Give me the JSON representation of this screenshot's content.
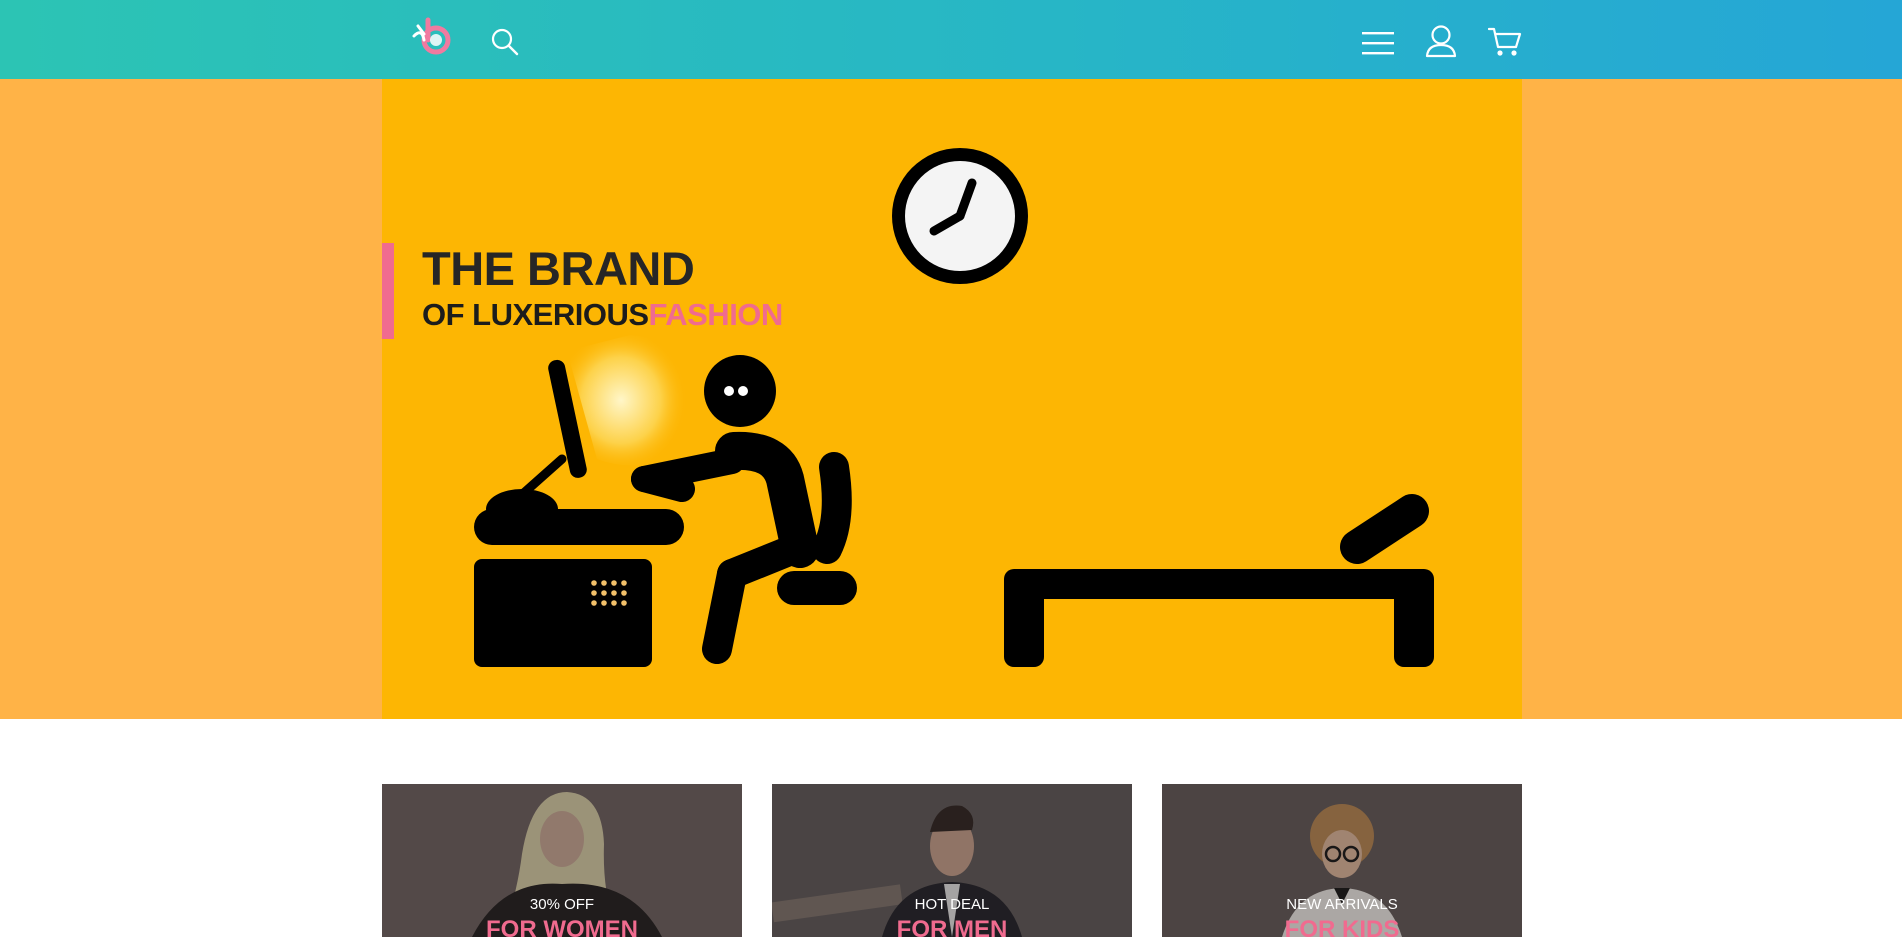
{
  "header": {
    "logo": "brand-logo",
    "icons": [
      "search-icon",
      "menu-icon",
      "user-icon",
      "cart-icon"
    ]
  },
  "hero": {
    "title": "THE BRAND",
    "subtitle_main": "OF LUXERIOUS",
    "subtitle_accent": "FASHION",
    "illustration": "office-worker-desk-clock-bed"
  },
  "categories": [
    {
      "tag": "30% OFF",
      "title": "FOR WOMEN"
    },
    {
      "tag": "HOT DEAL",
      "title": "FOR MEN"
    },
    {
      "tag": "NEW ARRIVALS",
      "title": "FOR KIDS"
    }
  ],
  "colors": {
    "header_start": "#2cc4b4",
    "header_end": "#25a6d6",
    "hero_side": "#ffb347",
    "hero_center": "#fdb603",
    "accent_pink": "#f06b8f",
    "ink": "#000000"
  }
}
